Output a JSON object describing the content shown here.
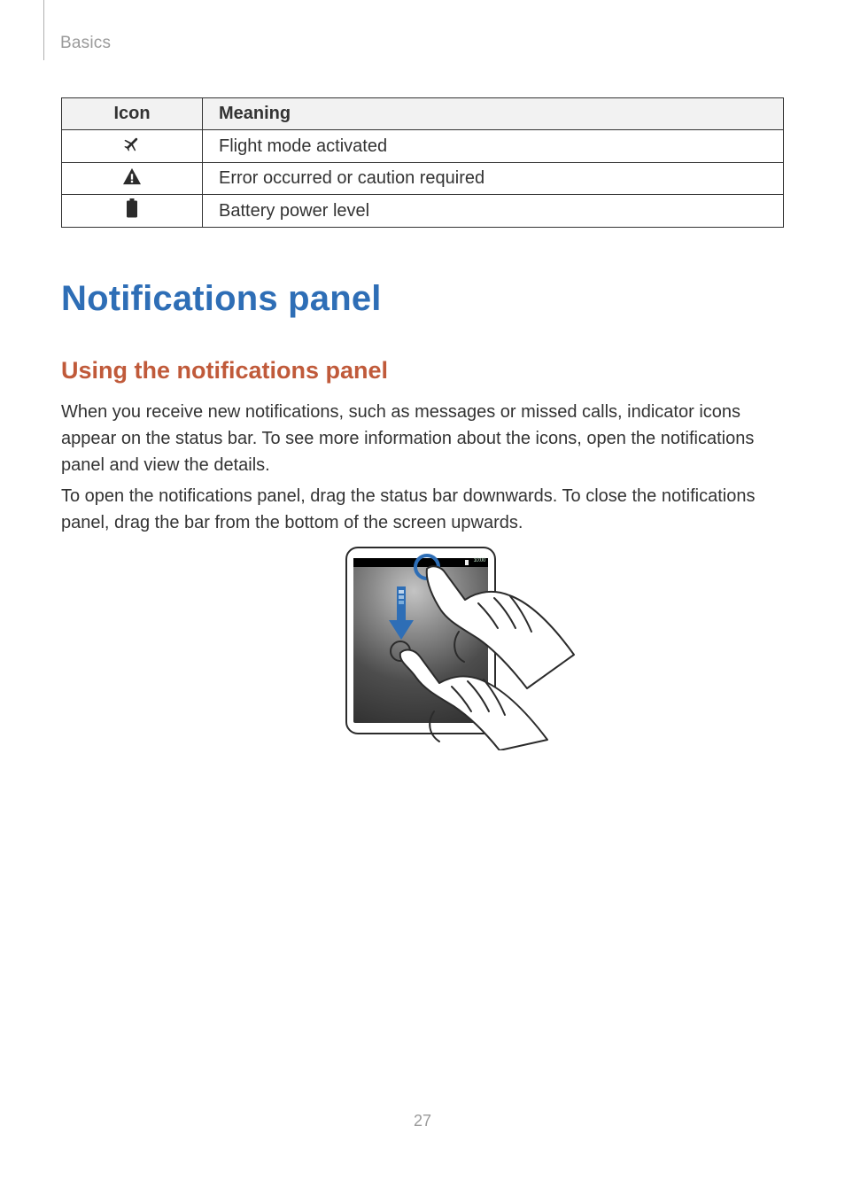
{
  "breadcrumb": "Basics",
  "table": {
    "headers": {
      "icon": "Icon",
      "meaning": "Meaning"
    },
    "rows": [
      {
        "icon": "airplane-icon",
        "meaning": "Flight mode activated"
      },
      {
        "icon": "warning-icon",
        "meaning": "Error occurred or caution required"
      },
      {
        "icon": "battery-icon",
        "meaning": "Battery power level"
      }
    ]
  },
  "heading1": "Notifications panel",
  "heading2": "Using the notifications panel",
  "paragraph1": "When you receive new notifications, such as messages or missed calls, indicator icons appear on the status bar. To see more information about the icons, open the notifications panel and view the details.",
  "paragraph2": "To open the notifications panel, drag the status bar downwards. To close the notifications panel, drag the bar from the bottom of the screen upwards.",
  "illustration": {
    "statusbar_time": "10:00"
  },
  "page_number": "27"
}
